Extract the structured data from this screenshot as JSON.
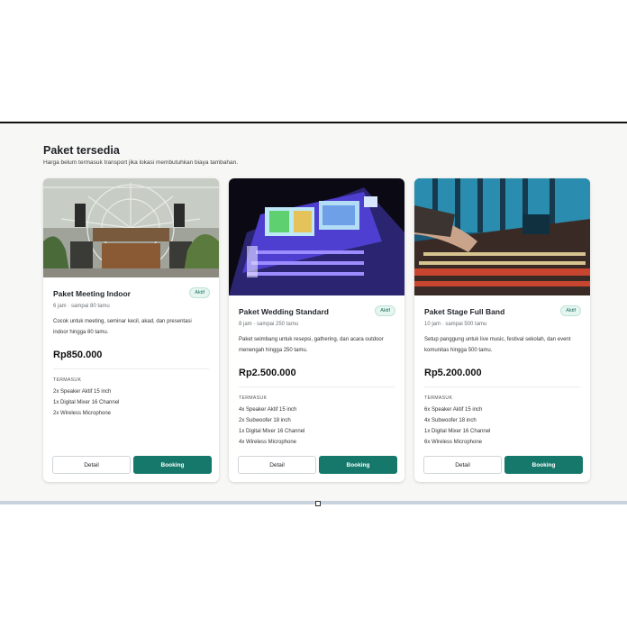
{
  "section": {
    "title": "Paket tersedia",
    "subtitle": "Harga belum termasuk transport jika lokasi membutuhkan biaya tambahan."
  },
  "packages": [
    {
      "name": "Paket Meeting Indoor",
      "status": "Aktif",
      "meta": "6 jam · sampai 80 tamu",
      "description": "Cocok untuk meeting, seminar kecil, akad, dan presentasi indoor hingga 80 tamu.",
      "price": "Rp850.000",
      "includes_label": "TERMASUK",
      "includes": [
        "2x Speaker Aktif 15 inch",
        "1x Digital Mixer 16 Channel",
        "2x Wireless Microphone"
      ],
      "detail_label": "Detail",
      "book_label": "Booking"
    },
    {
      "name": "Paket Wedding Standard",
      "status": "Aktif",
      "meta": "8 jam · sampai 250 tamu",
      "description": "Paket seimbang untuk resepsi, gathering, dan acara outdoor menengah hingga 250 tamu.",
      "price": "Rp2.500.000",
      "includes_label": "TERMASUK",
      "includes": [
        "4x Speaker Aktif 15 inch",
        "2x Subwoofer 18 inch",
        "1x Digital Mixer 16 Channel",
        "4x Wireless Microphone"
      ],
      "detail_label": "Detail",
      "book_label": "Booking"
    },
    {
      "name": "Paket Stage Full Band",
      "status": "Aktif",
      "meta": "10 jam · sampai 500 tamu",
      "description": "Setup panggung untuk live music, festival sekolah, dan event komunitas hingga 500 tamu.",
      "price": "Rp5.200.000",
      "includes_label": "TERMASUK",
      "includes": [
        "6x Speaker Aktif 15 inch",
        "4x Subwoofer 18 inch",
        "1x Digital Mixer 16 Channel",
        "6x Wireless Microphone"
      ],
      "detail_label": "Detail",
      "book_label": "Booking"
    }
  ],
  "colors": {
    "accent": "#15786b",
    "badge_bg": "#e5f5ef",
    "panel_bg": "#f7f7f5"
  }
}
